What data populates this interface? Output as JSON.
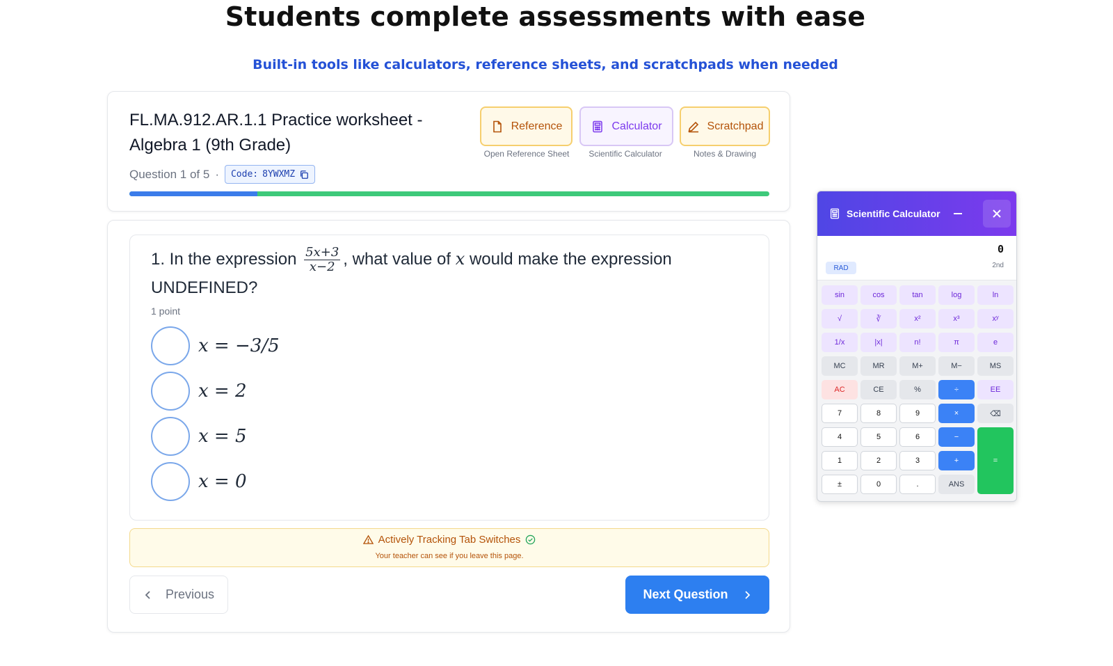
{
  "hero": {
    "title": "Students complete assessments with ease",
    "subtitle": "Built-in tools like calculators, reference sheets, and scratchpads when needed"
  },
  "worksheet": {
    "title": "FL.MA.912.AR.1.1 Practice worksheet - Algebra 1 (9th Grade)",
    "question_counter": "Question 1 of 5",
    "separator": "·",
    "code_label": "Code:",
    "code_value": "8YWXMZ",
    "progress_fraction": 0.2
  },
  "tools": [
    {
      "label": "Reference",
      "caption": "Open Reference Sheet",
      "icon": "file-icon"
    },
    {
      "label": "Calculator",
      "caption": "Scientific Calculator",
      "icon": "calculator-icon"
    },
    {
      "label": "Scratchpad",
      "caption": "Notes & Drawing",
      "icon": "pencil-icon"
    }
  ],
  "question": {
    "prefix": "1. In the expression",
    "frac_num": "5x+3",
    "frac_den": "x−2",
    "middle": ", what value of",
    "var": "x",
    "suffix": "would make the expression UNDEFINED?",
    "points": "1 point",
    "options": [
      "x = −3/5",
      "x = 2",
      "x = 5",
      "x = 0"
    ]
  },
  "tracking": {
    "title": "Actively Tracking Tab Switches",
    "note": "Your teacher can see if you leave this page."
  },
  "nav": {
    "previous": "Previous",
    "next": "Next Question"
  },
  "calculator": {
    "title": "Scientific Calculator",
    "display": "0",
    "mode": "RAD",
    "second": "2nd",
    "keys": {
      "sin": "sin",
      "cos": "cos",
      "tan": "tan",
      "log": "log",
      "ln": "ln",
      "sqrt": "√",
      "cbrt": "∛",
      "sq": "x²",
      "cube": "x³",
      "pow": "xʸ",
      "recip": "1/x",
      "abs": "|x|",
      "fact": "n!",
      "pi": "π",
      "e": "e",
      "mc": "MC",
      "mr": "MR",
      "mplus": "M+",
      "mminus": "M−",
      "ms": "MS",
      "ac": "AC",
      "ce": "CE",
      "pct": "%",
      "div": "÷",
      "ee": "EE",
      "n7": "7",
      "n8": "8",
      "n9": "9",
      "mul": "×",
      "back": "⌫",
      "n4": "4",
      "n5": "5",
      "n6": "6",
      "sub": "−",
      "n1": "1",
      "n2": "2",
      "n3": "3",
      "add": "+",
      "pm": "±",
      "n0": "0",
      "dot": ".",
      "ans": "ANS",
      "eq": "="
    }
  },
  "colors": {
    "accent_blue": "#2d7ff0",
    "progress_green": "#3ec97a",
    "calc_header": "#5b3ff0",
    "equals_green": "#22c55e"
  }
}
